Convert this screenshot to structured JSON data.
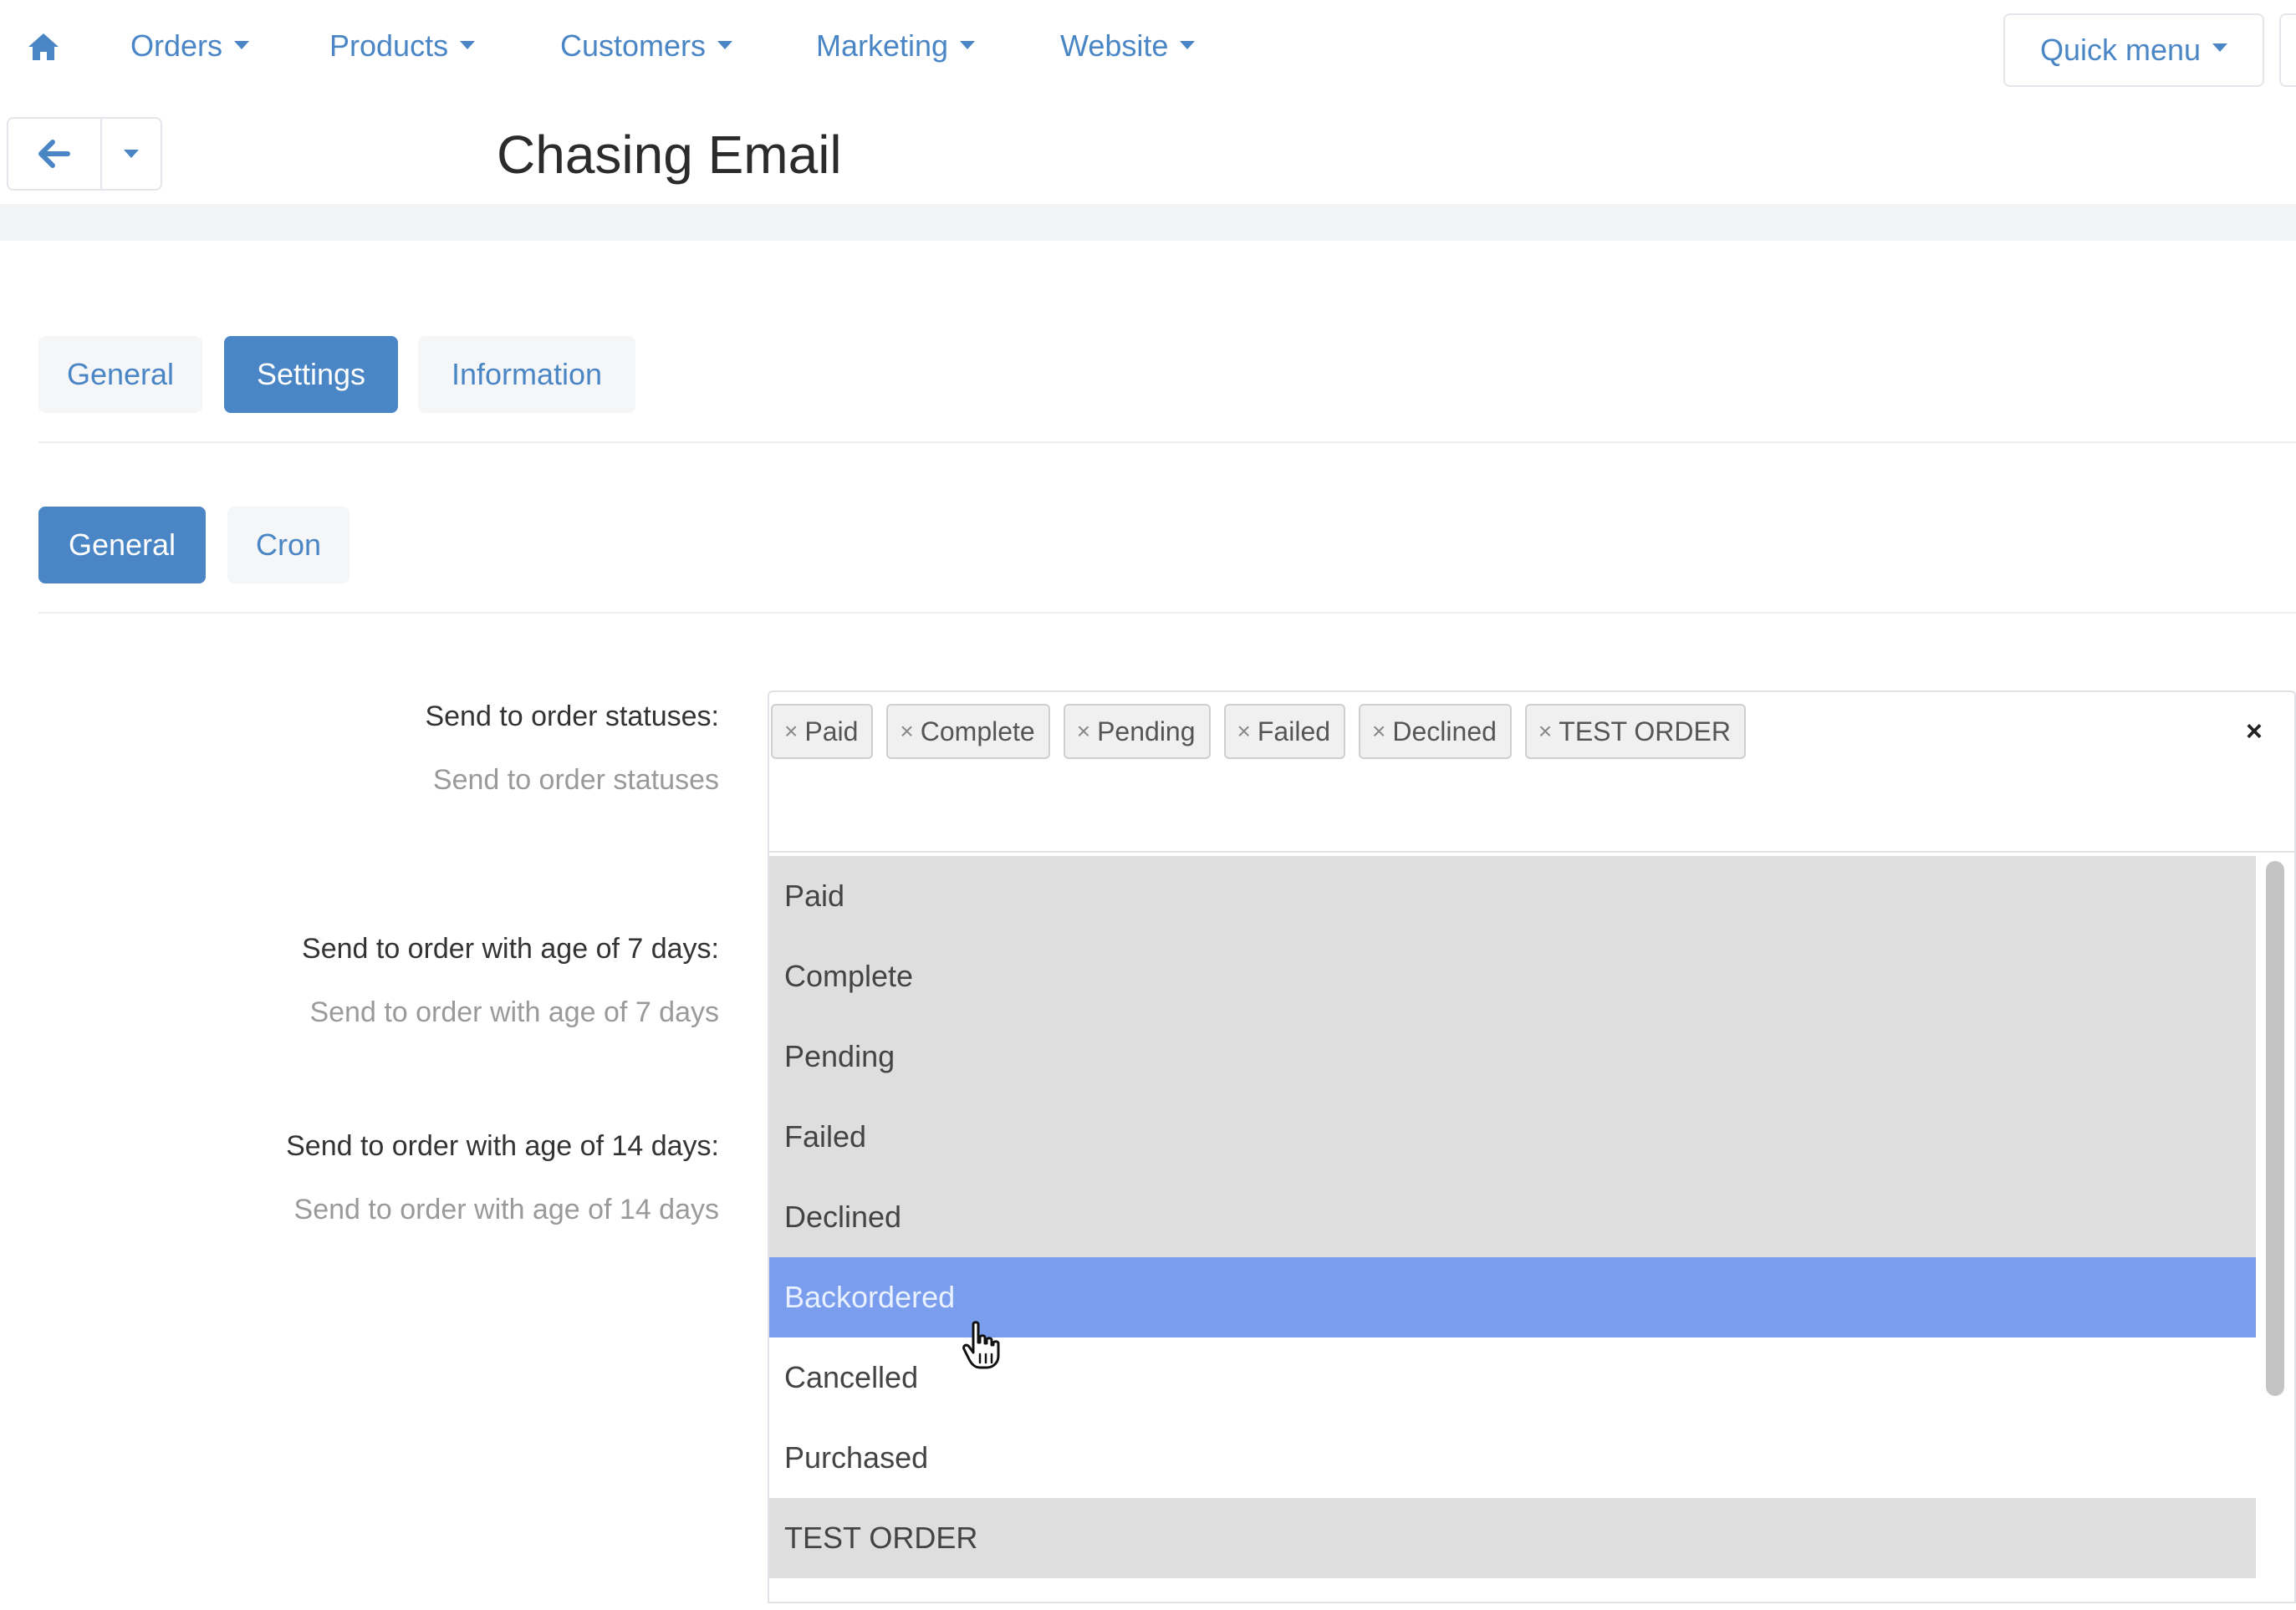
{
  "nav": {
    "home_icon": "home-icon",
    "items": [
      {
        "label": "Orders"
      },
      {
        "label": "Products"
      },
      {
        "label": "Customers"
      },
      {
        "label": "Marketing"
      },
      {
        "label": "Website"
      }
    ],
    "quick_menu": "Quick menu"
  },
  "titlebar": {
    "back_icon": "arrow-left-icon",
    "title": "Chasing Email"
  },
  "tabs": {
    "primary": [
      {
        "label": "General",
        "active": false
      },
      {
        "label": "Settings",
        "active": true
      },
      {
        "label": "Information",
        "active": false
      }
    ],
    "secondary": [
      {
        "label": "General",
        "active": true
      },
      {
        "label": "Cron",
        "active": false
      }
    ]
  },
  "form": {
    "statuses_label": "Send to order statuses:",
    "statuses_hint": "Send to order statuses",
    "age7_label": "Send to order with age of 7 days:",
    "age7_hint": "Send to order with age of 7 days",
    "age14_label": "Send to order with age of 14 days:",
    "age14_hint": "Send to order with age of 14 days"
  },
  "multiselect": {
    "tag_remove_glyph": "×",
    "clear_glyph": "×",
    "selected_tags": [
      "Paid",
      "Complete",
      "Pending",
      "Failed",
      "Declined",
      "TEST ORDER"
    ],
    "options": [
      {
        "label": "Paid",
        "state": "selected"
      },
      {
        "label": "Complete",
        "state": "selected"
      },
      {
        "label": "Pending",
        "state": "selected"
      },
      {
        "label": "Failed",
        "state": "selected"
      },
      {
        "label": "Declined",
        "state": "selected"
      },
      {
        "label": "Backordered",
        "state": "highlighted"
      },
      {
        "label": "Cancelled",
        "state": "none"
      },
      {
        "label": "Purchased",
        "state": "none"
      },
      {
        "label": "TEST ORDER",
        "state": "selected"
      }
    ]
  },
  "colors": {
    "accent": "#4a86c5",
    "highlight": "#7a9eed",
    "selected_option": "#dedede"
  }
}
